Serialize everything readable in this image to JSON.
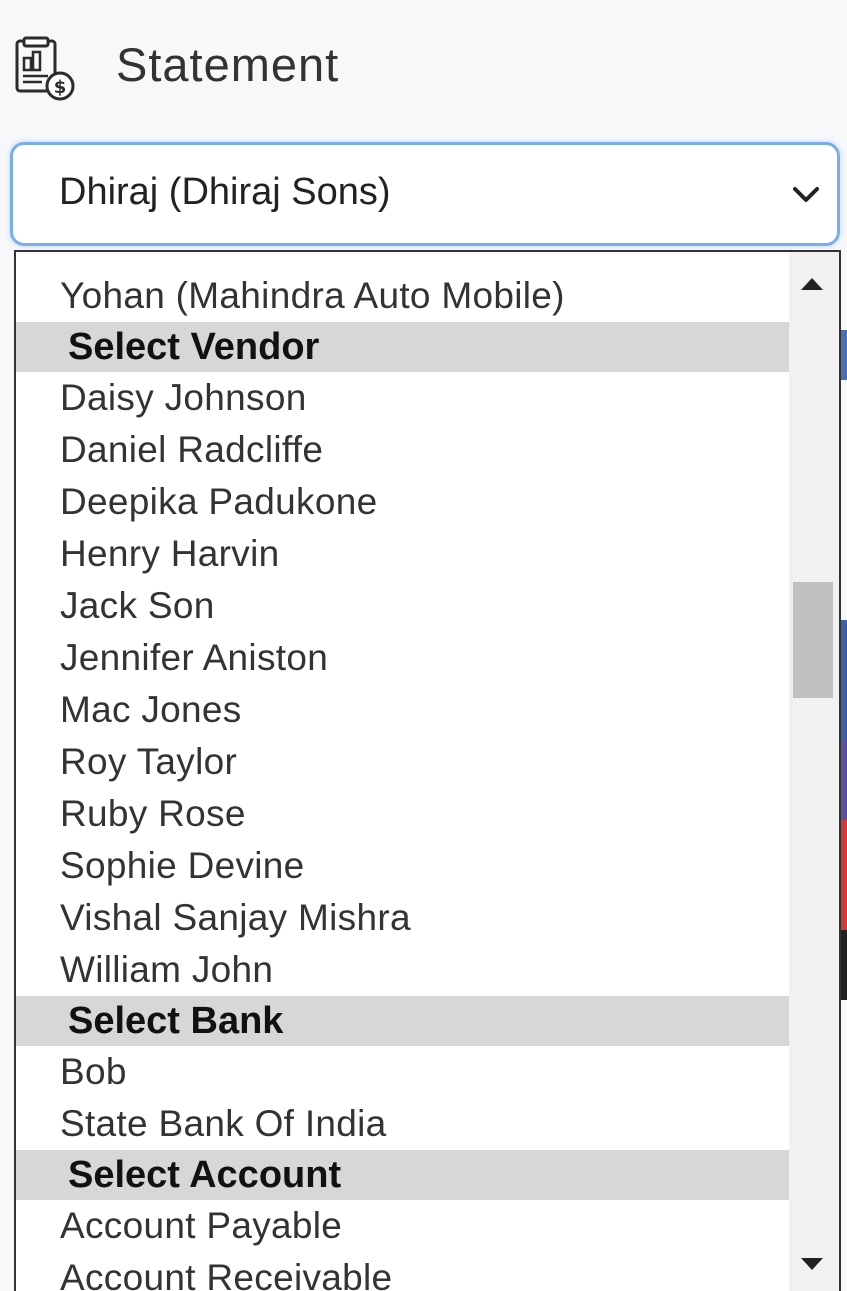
{
  "header": {
    "title": "Statement",
    "icon": "statement-icon"
  },
  "select": {
    "value": "Dhiraj (Dhiraj Sons)",
    "icon": "chevron-down-icon"
  },
  "dropdown": {
    "items": [
      {
        "type": "option",
        "label": "Yohan (Mahindra Auto Mobile)"
      },
      {
        "type": "group",
        "label": "Select Vendor"
      },
      {
        "type": "option",
        "label": "Daisy Johnson"
      },
      {
        "type": "option",
        "label": "Daniel Radcliffe"
      },
      {
        "type": "option",
        "label": "Deepika Padukone"
      },
      {
        "type": "option",
        "label": "Henry Harvin"
      },
      {
        "type": "option",
        "label": "Jack Son"
      },
      {
        "type": "option",
        "label": "Jennifer Aniston"
      },
      {
        "type": "option",
        "label": "Mac Jones"
      },
      {
        "type": "option",
        "label": "Roy Taylor"
      },
      {
        "type": "option",
        "label": "Ruby Rose"
      },
      {
        "type": "option",
        "label": "Sophie Devine"
      },
      {
        "type": "option",
        "label": "Vishal Sanjay Mishra"
      },
      {
        "type": "option",
        "label": "William John"
      },
      {
        "type": "group",
        "label": "Select Bank"
      },
      {
        "type": "option",
        "label": "Bob"
      },
      {
        "type": "option",
        "label": "State Bank Of India"
      },
      {
        "type": "group",
        "label": "Select Account"
      },
      {
        "type": "option",
        "label": "Account Payable"
      },
      {
        "type": "option",
        "label": "Account Receivable"
      }
    ],
    "scroll_position": 0.33
  },
  "colors": {
    "focus_border": "#7aaee8",
    "group_background": "#d7d7d7",
    "scroll_thumb": "#c1c1c1"
  }
}
